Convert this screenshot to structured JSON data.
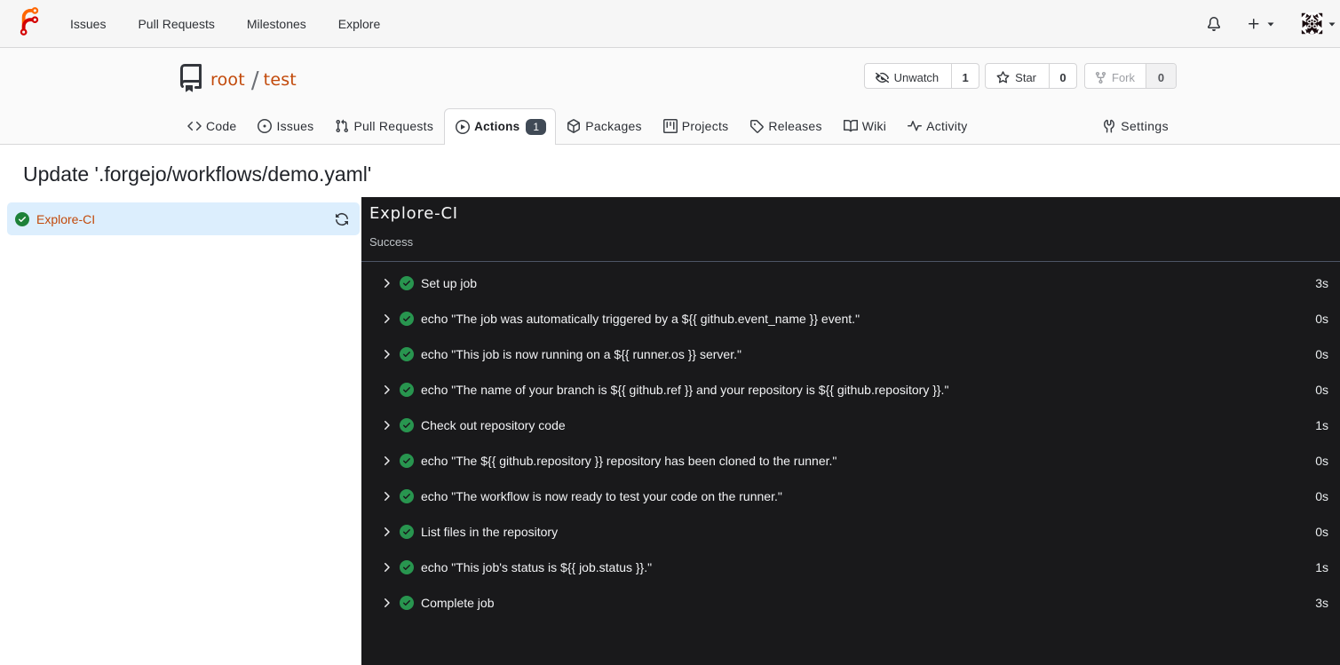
{
  "navbar": {
    "items": [
      {
        "label": "Issues"
      },
      {
        "label": "Pull Requests"
      },
      {
        "label": "Milestones"
      },
      {
        "label": "Explore"
      }
    ]
  },
  "repo": {
    "owner": "root",
    "separator": "/",
    "name": "test",
    "buttons": {
      "unwatch": {
        "label": "Unwatch",
        "count": "1"
      },
      "star": {
        "label": "Star",
        "count": "0"
      },
      "fork": {
        "label": "Fork",
        "count": "0"
      }
    },
    "tabs": [
      {
        "label": "Code",
        "icon": "code",
        "active": false
      },
      {
        "label": "Issues",
        "icon": "issue",
        "active": false
      },
      {
        "label": "Pull Requests",
        "icon": "pr",
        "active": false
      },
      {
        "label": "Actions",
        "icon": "play",
        "active": true,
        "badge": "1"
      },
      {
        "label": "Packages",
        "icon": "package",
        "active": false
      },
      {
        "label": "Projects",
        "icon": "project",
        "active": false
      },
      {
        "label": "Releases",
        "icon": "tag",
        "active": false
      },
      {
        "label": "Wiki",
        "icon": "book",
        "active": false
      },
      {
        "label": "Activity",
        "icon": "pulse",
        "active": false
      }
    ],
    "settings_tab": {
      "label": "Settings",
      "icon": "tools"
    }
  },
  "run": {
    "title": "Update '.forgejo/workflows/demo.yaml'",
    "job": {
      "name": "Explore-CI"
    },
    "panel": {
      "title": "Explore-CI",
      "status": "Success"
    },
    "steps": [
      {
        "name": "Set up job",
        "duration": "3s"
      },
      {
        "name": "echo \"The job was automatically triggered by a ${{ github.event_name }} event.\"",
        "duration": "0s"
      },
      {
        "name": "echo \"This job is now running on a ${{ runner.os }} server.\"",
        "duration": "0s"
      },
      {
        "name": "echo \"The name of your branch is ${{ github.ref }} and your repository is ${{ github.repository }}.\"",
        "duration": "0s"
      },
      {
        "name": "Check out repository code",
        "duration": "1s"
      },
      {
        "name": "echo \"The ${{ github.repository }} repository has been cloned to the runner.\"",
        "duration": "0s"
      },
      {
        "name": "echo \"The workflow is now ready to test your code on the runner.\"",
        "duration": "0s"
      },
      {
        "name": "List files in the repository",
        "duration": "0s"
      },
      {
        "name": "echo \"This job's status is ${{ job.status }}.\"",
        "duration": "1s"
      },
      {
        "name": "Complete job",
        "duration": "3s"
      }
    ]
  },
  "colors": {
    "primary": "#c2490a",
    "logo_orange": "#ff6600",
    "logo_red": "#d40000",
    "success_green_light": "#1d7f37",
    "success_green_dark": "#2aa05a",
    "console_bg": "#19191b",
    "active_job_bg": "#dceefd",
    "badge_bg": "#404a56"
  }
}
